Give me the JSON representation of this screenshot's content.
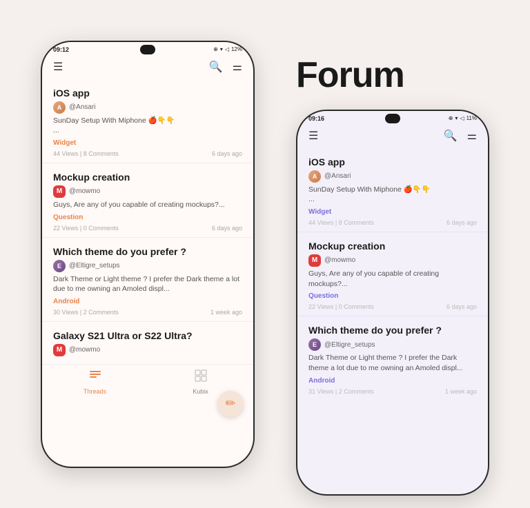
{
  "page": {
    "background": "#f5f0ee",
    "forum_title": "Forum"
  },
  "phone_light": {
    "status": {
      "time": "09:12",
      "icons_left": "@ ⊕ ▲ •",
      "icons_right": "⊕ ▾ ◁ 12%"
    },
    "nav": {
      "menu_icon": "☰",
      "search_icon": "🔍",
      "filter_icon": "⚌"
    },
    "posts": [
      {
        "title": "iOS app",
        "author": "@Ansari",
        "excerpt": "SunDay Setup With Miphone 🍎👇👇",
        "excerpt2": "...",
        "tag": "Widget",
        "tag_type": "widget",
        "views": "44 Views",
        "comments": "8 Comments",
        "time": "6 days ago"
      },
      {
        "title": "Mockup creation",
        "author": "@mowmo",
        "excerpt": "Guys, Are any of you capable of creating mockups?...",
        "tag": "Question",
        "tag_type": "question",
        "views": "22 Views",
        "comments": "0 Comments",
        "time": "6 days ago"
      },
      {
        "title": "Which theme do you prefer ?",
        "author": "@Eltigre_setups",
        "excerpt": "Dark Theme or Light theme ? I prefer the Dark theme a lot due to me owning an Amoled displ...",
        "tag": "Android",
        "tag_type": "android",
        "views": "30 Views",
        "comments": "2 Comments",
        "time": "1 week ago"
      },
      {
        "title": "Galaxy S21 Ultra or S22 Ultra?",
        "author": "@mowmo",
        "excerpt": "",
        "tag": "",
        "tag_type": "",
        "views": "",
        "comments": "",
        "time": ""
      }
    ],
    "bottom_nav": {
      "threads_label": "Threads",
      "kubix_label": "Kubix"
    },
    "fab_icon": "✏️"
  },
  "phone_dark": {
    "status": {
      "time": "09:16",
      "icons_left": "📷 ✉ @ •",
      "icons_right": "⊕ ▾ ◁ 11%"
    },
    "nav": {
      "menu_icon": "☰",
      "search_icon": "🔍",
      "filter_icon": "⚌"
    },
    "posts": [
      {
        "title": "iOS app",
        "author": "@Ansari",
        "excerpt": "SunDay Setup With Miphone 🍎👇👇",
        "excerpt2": "...",
        "tag": "Widget",
        "tag_type": "widget-dark",
        "views": "44 Views",
        "comments": "8 Comments",
        "time": "6 days ago"
      },
      {
        "title": "Mockup creation",
        "author": "@mowmo",
        "excerpt": "Guys, Are any of you capable of creating mockups?...",
        "tag": "Question",
        "tag_type": "question-dark",
        "views": "22 Views",
        "comments": "0 Comments",
        "time": "6 days ago"
      },
      {
        "title": "Which theme do you prefer ?",
        "author": "@Eltigre_setups",
        "excerpt": "Dark Theme or Light theme ? I prefer the Dark theme a lot due to me owning an Amoled displ...",
        "tag": "Android",
        "tag_type": "android-dark",
        "views": "31 Views",
        "comments": "2 Comments",
        "time": "1 week ago"
      }
    ]
  }
}
